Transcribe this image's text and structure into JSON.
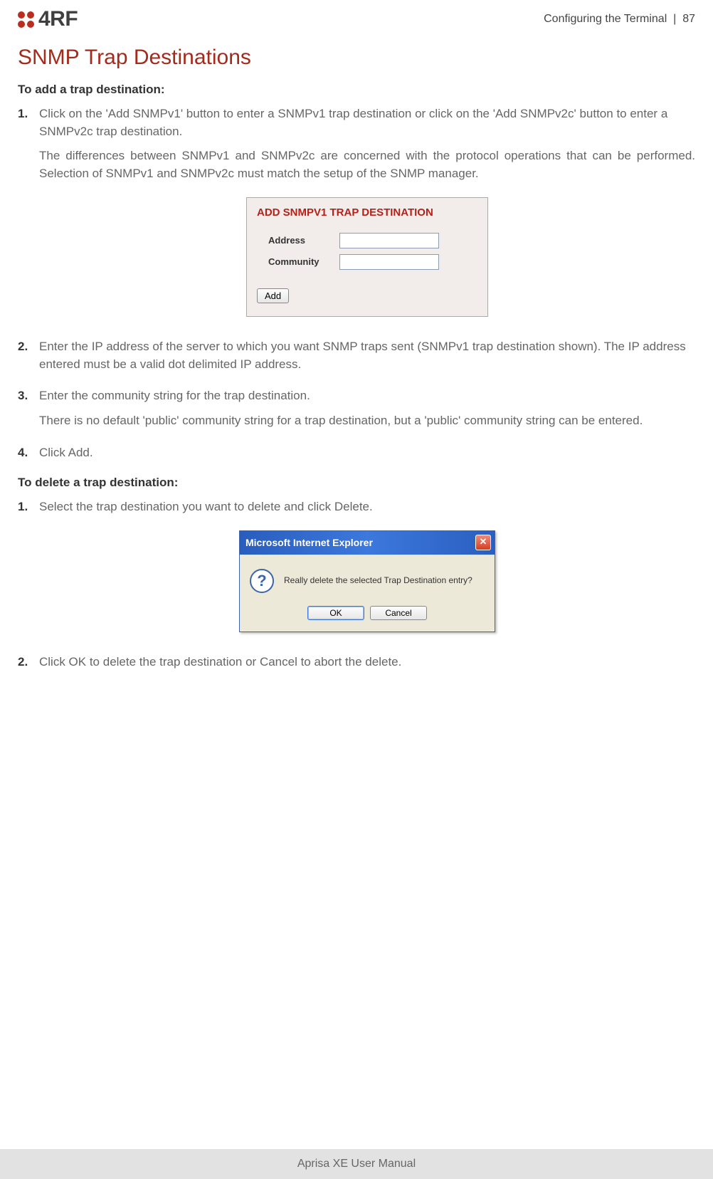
{
  "header": {
    "logo_text": "4RF",
    "section": "Configuring the Terminal",
    "page_number": "87"
  },
  "main": {
    "title": "SNMP Trap Destinations",
    "add_heading": "To add a trap destination:",
    "add_steps": [
      {
        "text": "Click on the 'Add SNMPv1' button to enter a SNMPv1 trap destination or click on the 'Add SNMPv2c' button to enter a SNMPv2c trap destination.",
        "extra": "The differences between SNMPv1 and SNMPv2c are concerned with the protocol operations that can be performed. Selection of SNMPv1 and SNMPv2c must match the setup of the SNMP manager."
      },
      {
        "text": "Enter the IP address of the server to which you want SNMP traps sent (SNMPv1 trap destination shown). The IP address entered must be a valid dot delimited IP address."
      },
      {
        "text": "Enter the community string for the trap destination.",
        "extra": "There is no default 'public' community string for a trap destination, but a 'public' community string can be entered."
      },
      {
        "text": "Click Add."
      }
    ],
    "delete_heading": "To delete a trap destination:",
    "delete_steps": [
      {
        "text": "Select the trap destination you want to delete and click Delete."
      },
      {
        "text": "Click OK to delete the trap destination or Cancel to abort the delete."
      }
    ],
    "snmp_dialog": {
      "title": "ADD SNMPV1 TRAP DESTINATION",
      "address_label": "Address",
      "community_label": "Community",
      "add_button": "Add"
    },
    "ie_dialog": {
      "title": "Microsoft Internet Explorer",
      "message": "Really delete the selected Trap Destination entry?",
      "ok": "OK",
      "cancel": "Cancel"
    }
  },
  "footer": {
    "text": "Aprisa XE User Manual"
  }
}
